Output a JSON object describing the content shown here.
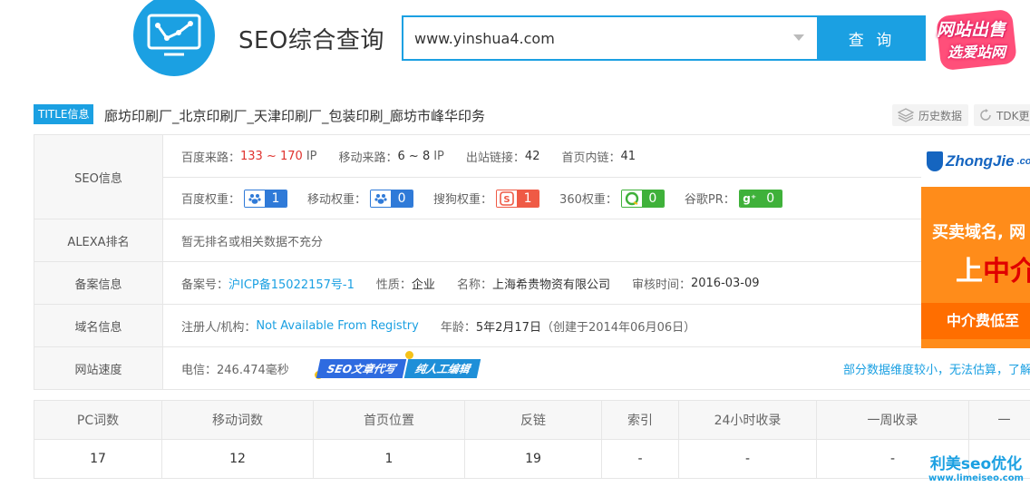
{
  "header": {
    "title": "SEO综合查询",
    "search_value": "www.yinshua4.com",
    "search_button": "查 询",
    "sale_line1": "网站出售",
    "sale_line2": "选爱站网"
  },
  "title_row": {
    "tag": "TITLE信息",
    "text": "廊坊印刷厂_北京印刷厂_天津印刷厂_包装印刷_廊坊市峰华印务",
    "history_button": "历史数据",
    "tdk_button": "TDK更"
  },
  "seo": {
    "label": "SEO信息",
    "baidu_traffic_label": "百度来路：",
    "baidu_traffic_value": "133 ~ 170",
    "baidu_traffic_unit": "IP",
    "mobile_traffic_label": "移动来路：",
    "mobile_traffic_value": "6 ~ 8",
    "mobile_traffic_unit": "IP",
    "outlinks_label": "出站链接：",
    "outlinks_value": "42",
    "homepage_links_label": "首页内链：",
    "homepage_links_value": "41",
    "weights": [
      {
        "label": "百度权重：",
        "value": "1",
        "color": "#2f7ad8",
        "icon": "baidu-paw-icon"
      },
      {
        "label": "移动权重：",
        "value": "0",
        "color": "#2f7ad8",
        "icon": "mobile-paw-icon"
      },
      {
        "label": "搜狗权重：",
        "value": "1",
        "color": "#ef5a45",
        "icon": "sogou-icon"
      },
      {
        "label": "360权重：",
        "value": "0",
        "color": "#3fb13a",
        "icon": "360-icon"
      },
      {
        "label": "谷歌PR：",
        "value": "0",
        "color": "#3fb13a",
        "icon": "google-plus-icon"
      }
    ]
  },
  "alexa": {
    "label": "ALEXA排名",
    "value": "暂无排名或相关数据不充分"
  },
  "icp": {
    "label": "备案信息",
    "number_label": "备案号：",
    "number_value": "沪ICP备15022157号-1",
    "type_label": "性质：",
    "type_value": "企业",
    "name_label": "名称：",
    "name_value": "上海希贵物资有限公司",
    "audit_label": "审核时间：",
    "audit_value": "2016-03-09"
  },
  "domain": {
    "label": "域名信息",
    "registrant_label": "注册人/机构：",
    "registrant_value": "Not Available From Registry",
    "age_label": "年龄：",
    "age_value": "5年2月17日",
    "created_value": "（创建于2014年06月06日）"
  },
  "speed": {
    "label": "网站速度",
    "value": "电信：246.474毫秒",
    "badge1": "SEO文章代写",
    "badge2": "纯人工编辑",
    "note": "部分数据维度较小，无法估算，了解"
  },
  "ad": {
    "brand": "ZhongJie",
    "brand_suffix": ".com",
    "line1": "买卖域名, 网",
    "line2_a": "上",
    "line2_b": "中介",
    "line3": "中介费低至"
  },
  "stats": {
    "headers": [
      "PC词数",
      "移动词数",
      "首页位置",
      "反链",
      "索引",
      "24小时收录",
      "一周收录",
      "一"
    ],
    "values": [
      "17",
      "12",
      "1",
      "19",
      "-",
      "-",
      "-",
      ""
    ]
  },
  "watermark": {
    "line1": "利美seo优化",
    "line2": "www.limeiseo.com"
  }
}
